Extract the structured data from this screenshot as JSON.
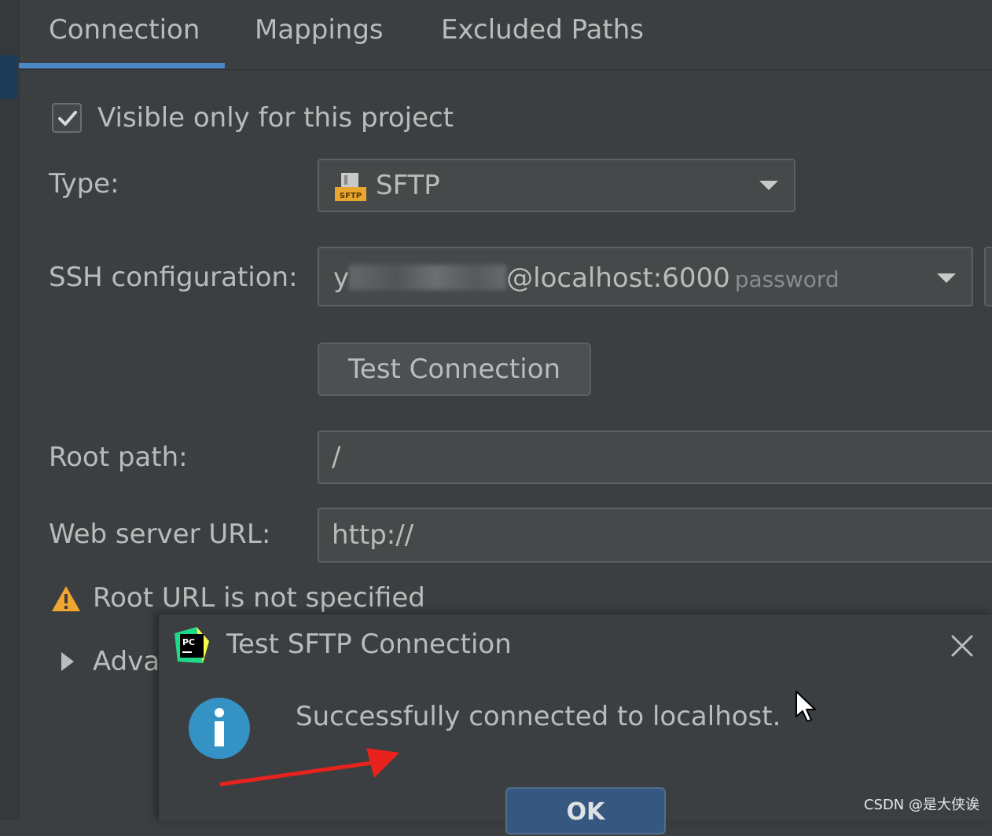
{
  "tabs": [
    {
      "label": "Connection",
      "active": true
    },
    {
      "label": "Mappings",
      "active": false
    },
    {
      "label": "Excluded Paths",
      "active": false
    }
  ],
  "form": {
    "visible_only_checkbox": {
      "label": "Visible only for this project",
      "checked": true
    },
    "type": {
      "label": "Type:",
      "value": "SFTP",
      "icon": "sftp-icon"
    },
    "ssh": {
      "label": "SSH configuration:",
      "value_prefix": "y",
      "value_suffix": "@localhost:6000",
      "hint": "password"
    },
    "test_button": "Test Connection",
    "root_path": {
      "label": "Root path:",
      "value": "/"
    },
    "web_server_url": {
      "label": "Web server URL:",
      "value": "http://"
    },
    "warning": "Root URL is not specified",
    "advanced": "Adva"
  },
  "dialog": {
    "title": "Test SFTP Connection",
    "message": "Successfully connected to localhost.",
    "ok_label": "OK"
  },
  "watermark": "CSDN @是大侠诶",
  "colors": {
    "accent": "#4a88c7",
    "warning": "#f0a732",
    "info": "#3592c4",
    "annotation_arrow": "#e8231d"
  }
}
